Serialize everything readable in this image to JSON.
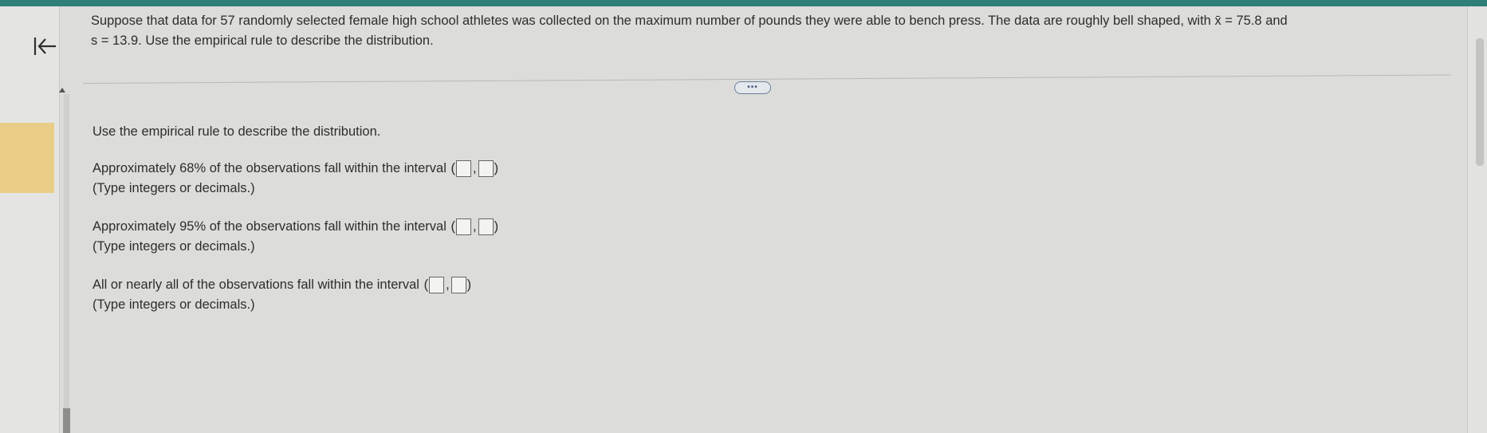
{
  "question": {
    "line1": "Suppose that data for 57 randomly selected female high school athletes was collected on the maximum number of pounds they were able to bench press. The data are roughly bell shaped, with x̄ = 75.8 and",
    "line2": "s = 13.9. Use the empirical rule to describe the distribution."
  },
  "divider": {
    "expand_label": "•••"
  },
  "content": {
    "intro": "Use the empirical rule to describe the distribution.",
    "items": [
      {
        "label": "Approximately 68% of the observations fall within the interval",
        "open": "(",
        "sep": ",",
        "close": ")",
        "hint": "(Type integers or decimals.)",
        "lower_value": "",
        "upper_value": ""
      },
      {
        "label": "Approximately 95% of the observations fall within the interval",
        "open": "(",
        "sep": ",",
        "close": ")",
        "hint": "(Type integers or decimals.)",
        "lower_value": "",
        "upper_value": ""
      },
      {
        "label": "All or nearly all of the observations fall within the interval",
        "open": "(",
        "sep": ",",
        "close": ")",
        "hint": "(Type integers or decimals.)",
        "lower_value": "",
        "upper_value": ""
      }
    ]
  },
  "colors": {
    "top_bar": "#2f7f78",
    "rail_highlight": "#e9cd86",
    "background": "#dcdcda"
  },
  "icons": {
    "back": "arrow-left-to-bar-icon",
    "expand": "ellipsis-icon",
    "scroll_up": "scroll-up-arrow-icon"
  }
}
